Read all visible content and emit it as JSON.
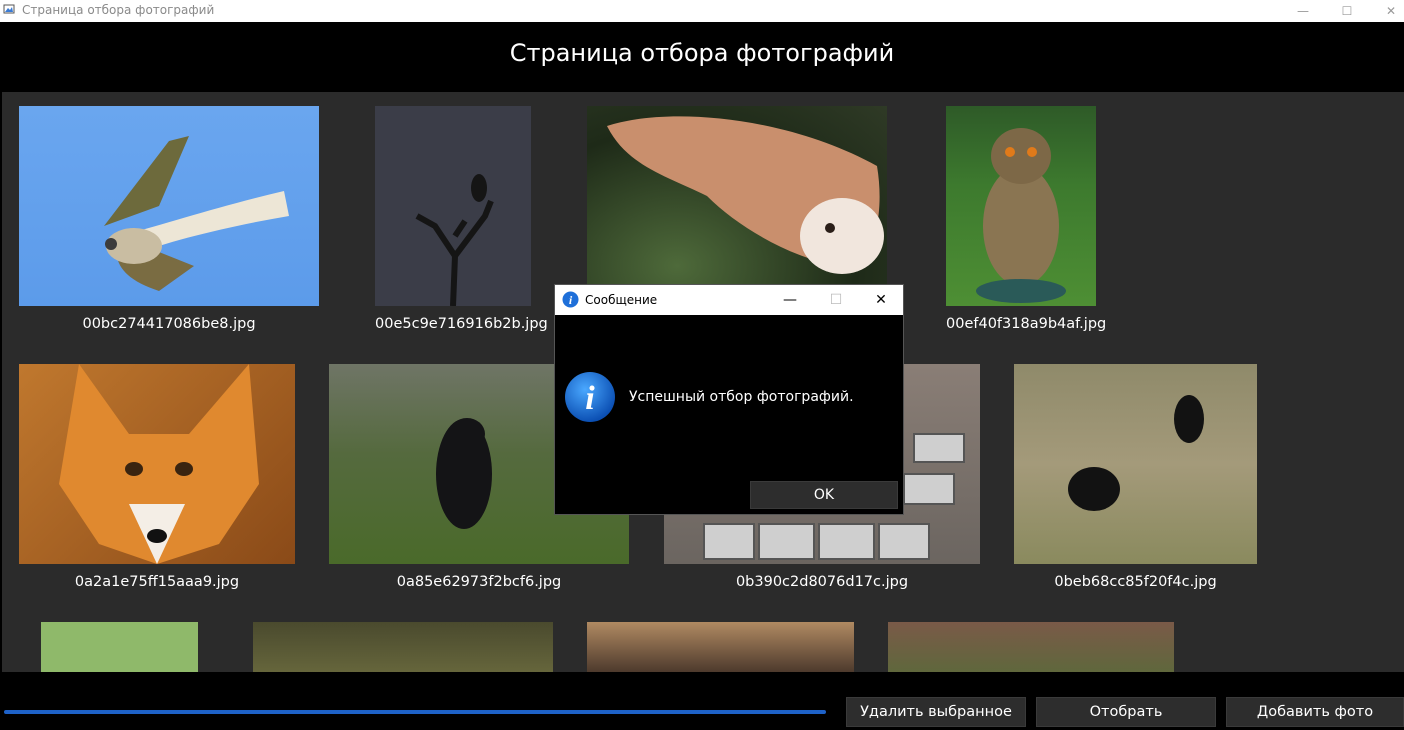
{
  "window": {
    "title": "Страница отбора фотографий",
    "minimize": "—",
    "maximize": "☐",
    "close": "✕"
  },
  "header": {
    "title": "Страница отбора фотографий"
  },
  "photos": [
    {
      "file": "00bc274417086be8.jpg",
      "subject": "kestrel"
    },
    {
      "file": "00e5c9e716916b2b.jpg",
      "subject": "owl-on-tree"
    },
    {
      "file": "",
      "subject": "barn-owl"
    },
    {
      "file": "00ef40f318a9b4af.jpg",
      "subject": "eagle-owl"
    },
    {
      "file": "0a2a1e75ff15aaa9.jpg",
      "subject": "fox"
    },
    {
      "file": "0a85e62973f2bcf6.jpg",
      "subject": "black-bear"
    },
    {
      "file": "0b390c2d8076d17c.jpg",
      "subject": "cobblestones"
    },
    {
      "file": "0beb68cc85f20f4c.jpg",
      "subject": "two-bears"
    },
    {
      "file": "",
      "subject": "grass"
    },
    {
      "file": "",
      "subject": "forest"
    },
    {
      "file": "",
      "subject": "bear-closeup"
    },
    {
      "file": "",
      "subject": "brush"
    }
  ],
  "footer": {
    "progress": 1.0,
    "delete_label": "Удалить выбранное",
    "select_label": "Отобрать",
    "add_label": "Добавить фото"
  },
  "dialog": {
    "title": "Сообщение",
    "message": "Успешный отбор фотографий.",
    "ok_label": "OK",
    "minimize": "—",
    "maximize": "☐",
    "close": "✕",
    "icon": "info-icon"
  },
  "colors": {
    "accent": "#1e62c8",
    "gallery_bg": "#2b2b2b",
    "button_bg": "#2d2d2d"
  }
}
